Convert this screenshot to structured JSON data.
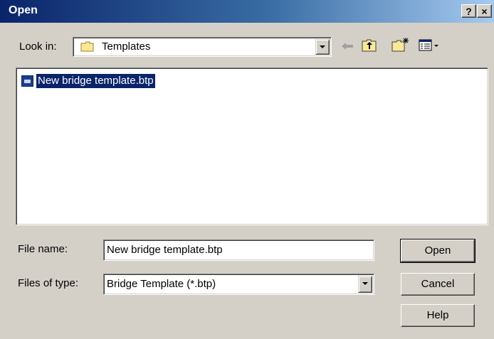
{
  "window": {
    "title": "Open",
    "help_label": "?",
    "close_label": "×"
  },
  "look_in": {
    "label": "Look in:",
    "value": "Templates"
  },
  "toolbar": {
    "back_icon": "back-arrow-icon",
    "up_icon": "up-one-level-icon",
    "new_folder_icon": "new-folder-icon",
    "views_icon": "view-menu-icon"
  },
  "files": [
    {
      "name": "New bridge template.btp",
      "selected": true,
      "icon": "bridge-template-file-icon"
    }
  ],
  "file_name": {
    "label": "File name:",
    "value": "New bridge template.btp"
  },
  "file_type": {
    "label": "Files of type:",
    "value": "Bridge Template (*.btp)"
  },
  "buttons": {
    "open": "Open",
    "cancel": "Cancel",
    "help": "Help"
  },
  "colors": {
    "title_start": "#0a246a",
    "title_end": "#a6caf0",
    "selection": "#0a246a",
    "face": "#d4d0c8"
  }
}
